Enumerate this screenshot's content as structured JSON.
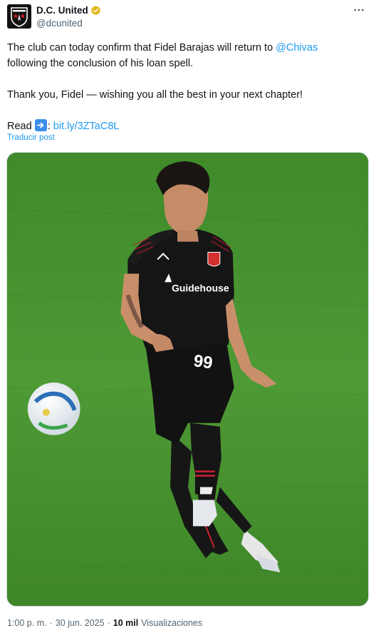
{
  "author": {
    "display_name": "D.C. United",
    "handle": "@dcunited",
    "avatar_icon": "dc-united-crest-icon",
    "verified_icon": "gold-verified-badge-icon",
    "verified_color": "#e2b719"
  },
  "tweet": {
    "line1_text": "The club can today confirm that Fidel Barajas will return to ",
    "line1_mention": "@Chivas",
    "line2_text": "following the conclusion of his loan spell.",
    "line3_text": "Thank you, Fidel — wishing you all the best in your next chapter!",
    "read_label": "Read",
    "read_emoji": "right-arrow-emoji-icon",
    "read_colon": ":",
    "link_text": "bit.ly/3ZTaC8L",
    "translate_label": "Traducir post"
  },
  "meta": {
    "time": "1:00 p. m.",
    "separator": "·",
    "date": "30 jun. 2025",
    "views_count": "10 mil",
    "views_label": "Visualizaciones"
  },
  "colors": {
    "link": "#1d9bf0",
    "secondary_text": "#536471",
    "primary_text": "#0f1419"
  }
}
